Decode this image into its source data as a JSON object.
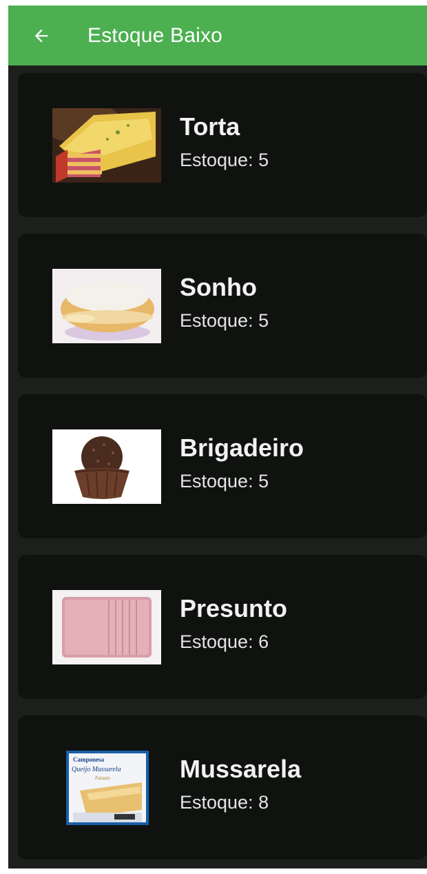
{
  "appbar": {
    "title": "Estoque Baixo",
    "back_icon": "arrow-left-icon",
    "color": "#4caf50"
  },
  "products": [
    {
      "name": "Torta",
      "stock": "Estoque: 5",
      "image": "torta-photo"
    },
    {
      "name": "Sonho",
      "stock": "Estoque: 5",
      "image": "sonho-photo"
    },
    {
      "name": "Brigadeiro",
      "stock": "Estoque: 5",
      "image": "brigadeiro-photo"
    },
    {
      "name": "Presunto",
      "stock": "Estoque: 6",
      "image": "presunto-photo"
    },
    {
      "name": "Mussarela",
      "stock": "Estoque: 8",
      "image": "mussarela-photo",
      "package_text": [
        "Camponesa",
        "Queijo Mussarela",
        "Fatiado"
      ]
    }
  ],
  "colors": {
    "background": "#1c1f1c",
    "card": "#0f120f"
  }
}
